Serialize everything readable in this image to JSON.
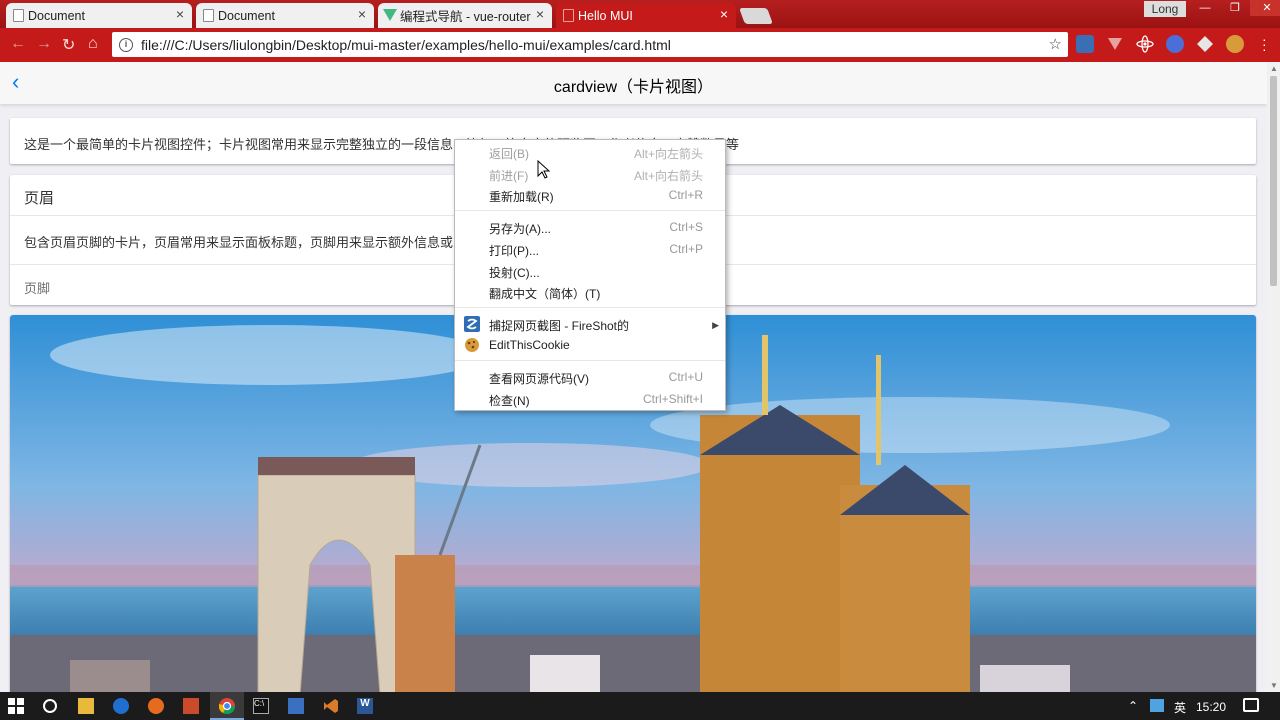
{
  "browser": {
    "tabs": [
      {
        "title": "Document",
        "active": false
      },
      {
        "title": "Document",
        "active": false
      },
      {
        "title": "编程式导航 - vue-router",
        "active": false
      },
      {
        "title": "Hello MUI",
        "active": true
      }
    ],
    "profile_name": "Long",
    "url": "file:///C:/Users/liulongbin/Desktop/mui-master/examples/hello-mui/examples/card.html",
    "close_glyph": "×",
    "accent_color": "#c41a1a"
  },
  "page": {
    "title": "cardview（卡片视图）",
    "card1_text": "这是一个最简单的卡片视图控件；卡片视图常用来显示完整独立的一段信息，比如一篇文章的预览图、作者信息、点赞数量等",
    "card2": {
      "header": "页眉",
      "body": "包含页眉页脚的卡片，页眉常用来显示面板标题，页脚用来显示额外信息或",
      "footer": "页脚"
    }
  },
  "context_menu": {
    "items": [
      {
        "label": "返回(B)",
        "shortcut": "Alt+向左箭头",
        "disabled": true
      },
      {
        "label": "前进(F)",
        "shortcut": "Alt+向右箭头",
        "disabled": true
      },
      {
        "label": "重新加载(R)",
        "shortcut": "Ctrl+R",
        "disabled": false
      },
      {
        "label": "另存为(A)...",
        "shortcut": "Ctrl+S",
        "disabled": false
      },
      {
        "label": "打印(P)...",
        "shortcut": "Ctrl+P",
        "disabled": false
      },
      {
        "label": "投射(C)...",
        "shortcut": "",
        "disabled": false
      },
      {
        "label": "翻成中文（简体）(T)",
        "shortcut": "",
        "disabled": false
      },
      {
        "label": "捕捉网页截图 - FireShot的",
        "shortcut": "",
        "disabled": false,
        "icon": "fireshot-icon",
        "submenu": true
      },
      {
        "label": "EditThisCookie",
        "shortcut": "",
        "disabled": false,
        "icon": "cookie-icon"
      },
      {
        "label": "查看网页源代码(V)",
        "shortcut": "Ctrl+U",
        "disabled": false
      },
      {
        "label": "检查(N)",
        "shortcut": "Ctrl+Shift+I",
        "disabled": false
      }
    ]
  },
  "taskbar": {
    "ime": "英",
    "clock": "15:20"
  }
}
